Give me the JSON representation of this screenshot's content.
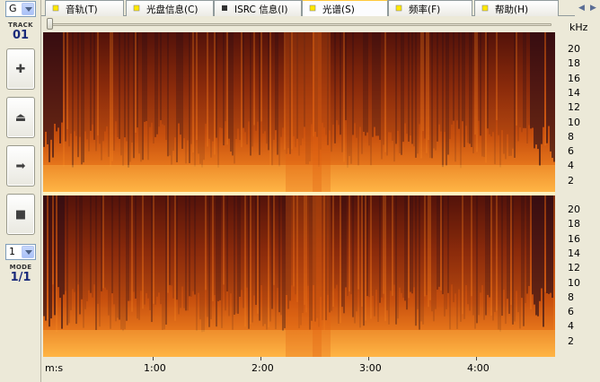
{
  "left_panel": {
    "drive_select": "G",
    "track_label": "TRACK",
    "track_number": "01",
    "buttons": [
      {
        "name": "add-button",
        "glyph": "✚"
      },
      {
        "name": "eject-button",
        "glyph": "⏏"
      },
      {
        "name": "play-button",
        "glyph": "➡"
      },
      {
        "name": "stop-button",
        "glyph": "■"
      }
    ],
    "mode_select": "1",
    "mode_label": "MODE",
    "mode_value": "1/1"
  },
  "tabs": [
    {
      "label": "音轨(T)",
      "active": false
    },
    {
      "label": "光盘信息(C)",
      "active": false
    },
    {
      "label": "ISRC 信息(I)",
      "active": false
    },
    {
      "label": "光谱(S)",
      "active": true
    },
    {
      "label": "频率(F)",
      "active": false
    },
    {
      "label": "帮助(H)",
      "active": false
    }
  ],
  "tab_scroll": {
    "left": "◀",
    "right": "▶"
  },
  "yaxis": {
    "unit": "kHz",
    "ticks": [
      "20",
      "18",
      "16",
      "14",
      "12",
      "10",
      "8",
      "6",
      "4",
      "2"
    ]
  },
  "xaxis": {
    "unit_label": "m:s",
    "ticks": [
      "1:00",
      "2:00",
      "3:00",
      "4:00"
    ]
  },
  "colors": {
    "spectro_low": "#1a0a30",
    "spectro_mid": "#c0430a",
    "spectro_high": "#ffd060",
    "tab_active_accent": "#ffc83c"
  }
}
